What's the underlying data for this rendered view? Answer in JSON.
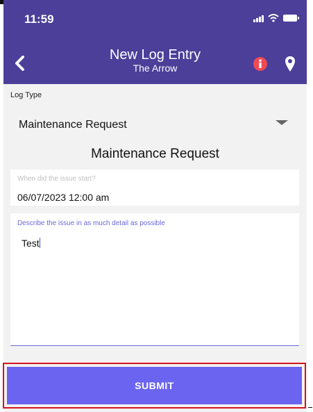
{
  "status_bar": {
    "time": "11:59"
  },
  "header": {
    "title": "New Log Entry",
    "subtitle": "The Arrow",
    "back_icon": "chevron-left",
    "info_icon": "info-circle",
    "location_icon": "map-pin"
  },
  "form": {
    "log_type_label": "Log Type",
    "log_type_value": "Maintenance Request",
    "section_title": "Maintenance Request",
    "issue_start": {
      "label": "When did the issue start?",
      "value": "06/07/2023 12:00 am"
    },
    "description": {
      "label": "Describe the issue in as much detail as possible",
      "value": "Test"
    }
  },
  "actions": {
    "submit_label": "SUBMIT"
  },
  "colors": {
    "header_bg": "#4b3f9a",
    "accent": "#6b64f0",
    "info_red": "#f04a55",
    "highlight_border": "#d4141b"
  }
}
